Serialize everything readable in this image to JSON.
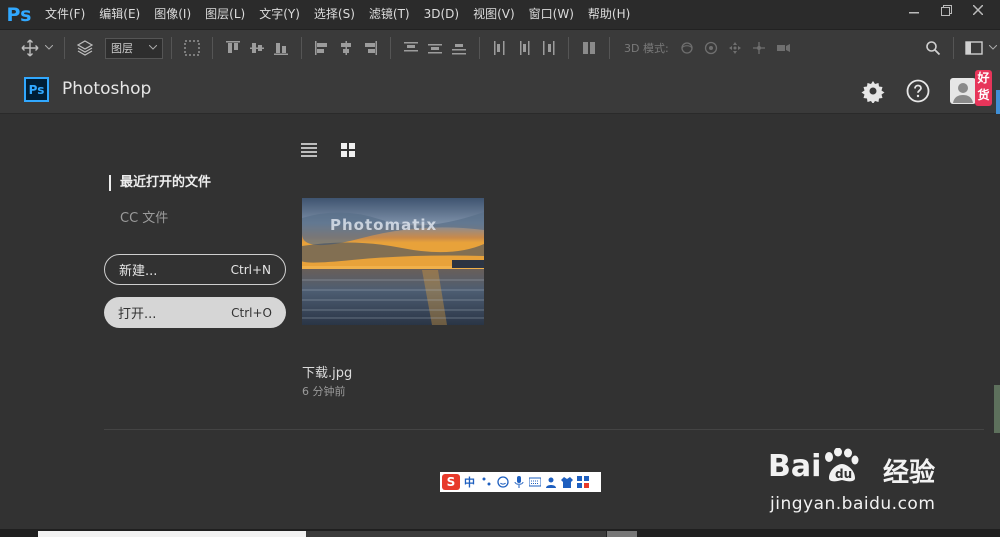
{
  "app": {
    "logo": "Ps",
    "name": "Photoshop",
    "badge": "Ps"
  },
  "menu": [
    "文件(F)",
    "编辑(E)",
    "图像(I)",
    "图层(L)",
    "文字(Y)",
    "选择(S)",
    "滤镜(T)",
    "3D(D)",
    "视图(V)",
    "窗口(W)",
    "帮助(H)"
  ],
  "window_controls": [
    "minimize-icon",
    "restore-icon",
    "close-icon"
  ],
  "options_bar": {
    "layer_select": "图层",
    "mode_label": "3D 模式:"
  },
  "header_icons": [
    "gear-icon",
    "help-icon",
    "account-icon"
  ],
  "badge_hao": "好货",
  "nav": {
    "recent": "最近打开的文件",
    "cc": "CC 文件"
  },
  "buttons": {
    "new": {
      "label": "新建...",
      "shortcut": "Ctrl+N"
    },
    "open": {
      "label": "打开...",
      "shortcut": "Ctrl+O"
    }
  },
  "recent_files": [
    {
      "name": "下载.jpg",
      "time": "6 分钟前",
      "thumb_text": "Photomatix"
    }
  ],
  "ime": {
    "logo": "S",
    "lang": "中"
  },
  "watermark": {
    "logo": "Bai",
    "logo_suffix": "经验",
    "url": "jingyan.baidu.com"
  },
  "colors": {
    "accent": "#31a8ff",
    "badge_red": "#e7355a",
    "bg": "#323232"
  }
}
